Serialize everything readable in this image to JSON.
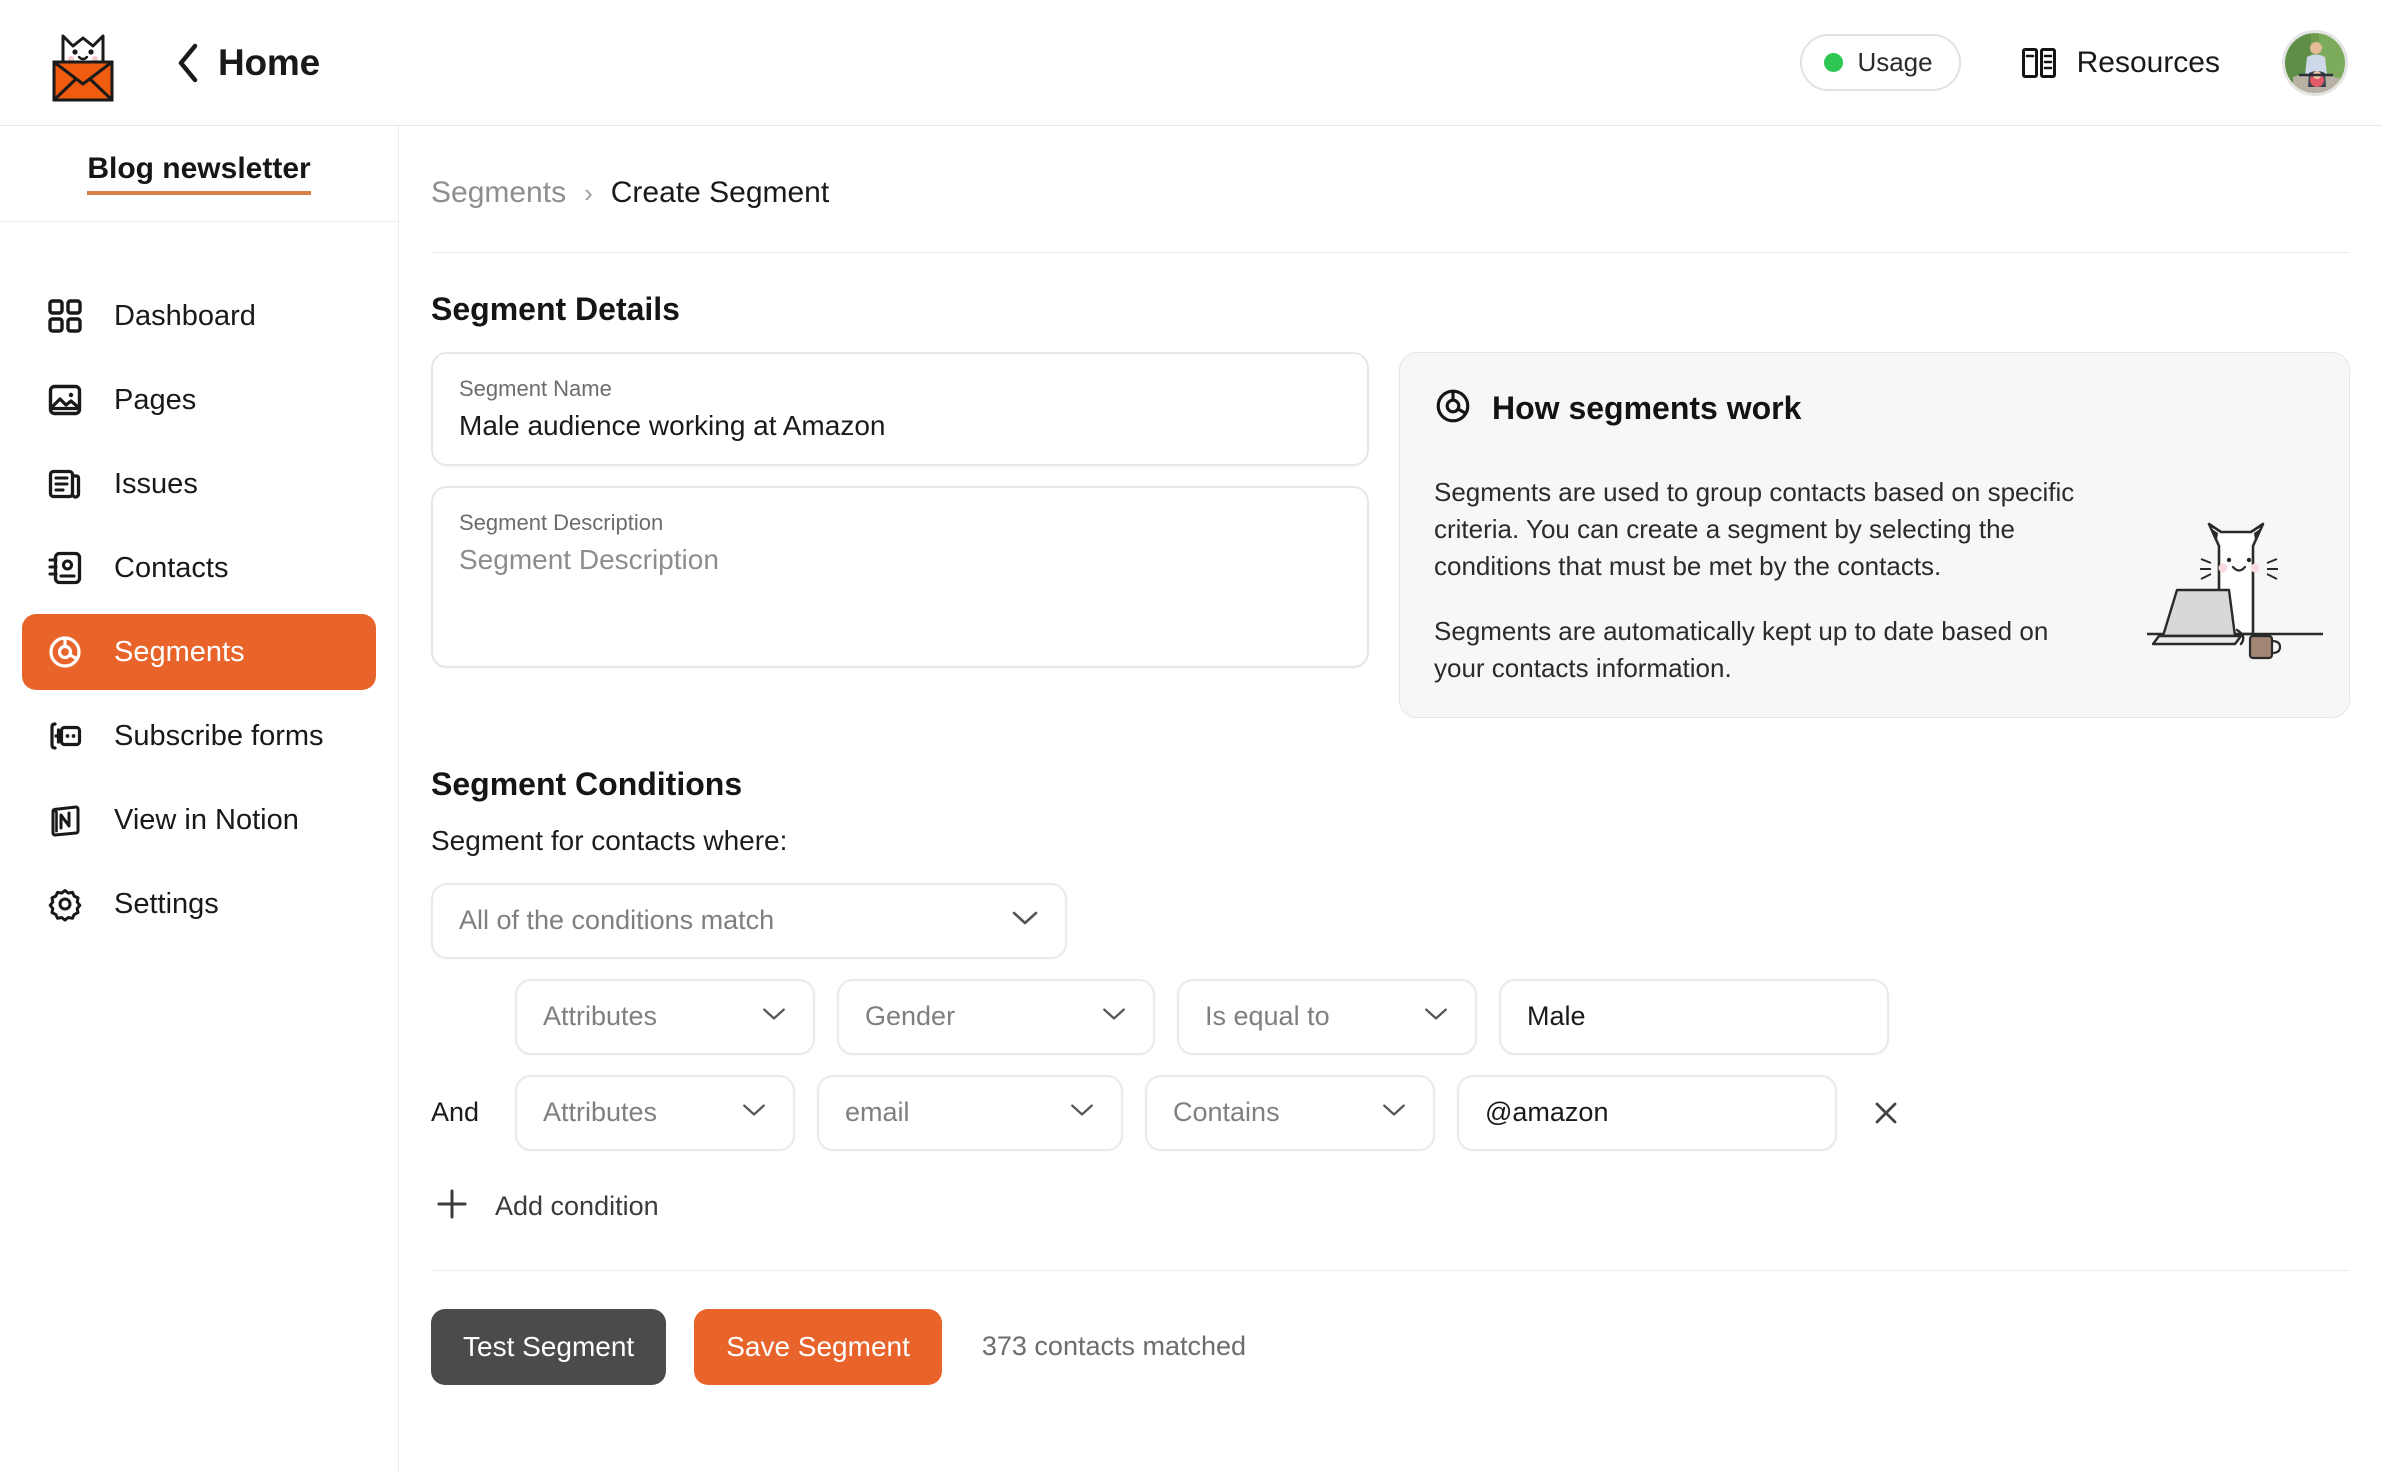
{
  "header": {
    "back_label": "Home",
    "back_icon": "chevron-left-icon",
    "logo_icon": "cat-envelope-logo",
    "usage": {
      "label": "Usage",
      "status_color": "#2dc653"
    },
    "resources": {
      "label": "Resources",
      "icon": "book-icon"
    },
    "avatar": {
      "icon": "user-avatar-photo"
    }
  },
  "sidebar": {
    "brand": "Blog newsletter",
    "brand_underline_color": "#d98047",
    "active_color": "#e8642a",
    "items": [
      {
        "label": "Dashboard",
        "icon": "grid-icon",
        "active": false
      },
      {
        "label": "Pages",
        "icon": "image-icon",
        "active": false
      },
      {
        "label": "Issues",
        "icon": "newspaper-icon",
        "active": false
      },
      {
        "label": "Contacts",
        "icon": "contact-book-icon",
        "active": false
      },
      {
        "label": "Segments",
        "icon": "donut-chart-icon",
        "active": true
      },
      {
        "label": "Subscribe forms",
        "icon": "form-icon",
        "active": false
      },
      {
        "label": "View in Notion",
        "icon": "notion-icon",
        "active": false
      },
      {
        "label": "Settings",
        "icon": "gear-icon",
        "active": false
      }
    ]
  },
  "breadcrumb": {
    "parent": "Segments",
    "separator": "›",
    "current": "Create Segment"
  },
  "details": {
    "title": "Segment Details",
    "name_field": {
      "label": "Segment Name",
      "value": "Male audience working at Amazon"
    },
    "description_field": {
      "label": "Segment Description",
      "placeholder": "Segment Description",
      "value": ""
    }
  },
  "info_card": {
    "icon": "donut-chart-icon",
    "title": "How segments work",
    "paragraphs": [
      "Segments are used to group contacts based on specific criteria. You can create a segment by selecting the conditions that must be met by the contacts.",
      "Segments are automatically kept up to date based on your contacts information."
    ],
    "illustration": "cat-at-laptop-illustration"
  },
  "conditions": {
    "title": "Segment Conditions",
    "subtitle": "Segment for contacts where:",
    "match_select": {
      "value": "All of the conditions match",
      "icon": "chevron-down-icon"
    },
    "rows": [
      {
        "conjunction": "",
        "attribute": "Attributes",
        "property": "Gender",
        "operator": "Is equal to",
        "value": "Male",
        "value_is_placeholder": false,
        "removable": false
      },
      {
        "conjunction": "And",
        "attribute": "Attributes",
        "property": "email",
        "operator": "Contains",
        "value": "@amazon",
        "value_is_placeholder": false,
        "removable": true,
        "remove_icon": "close-icon"
      }
    ],
    "add_condition": {
      "label": "Add condition",
      "icon": "plus-icon"
    }
  },
  "actions": {
    "test_label": "Test Segment",
    "save_label": "Save Segment",
    "matched_text": "373 contacts matched",
    "test_color": "#4b4b4b",
    "save_color": "#e8642a"
  }
}
